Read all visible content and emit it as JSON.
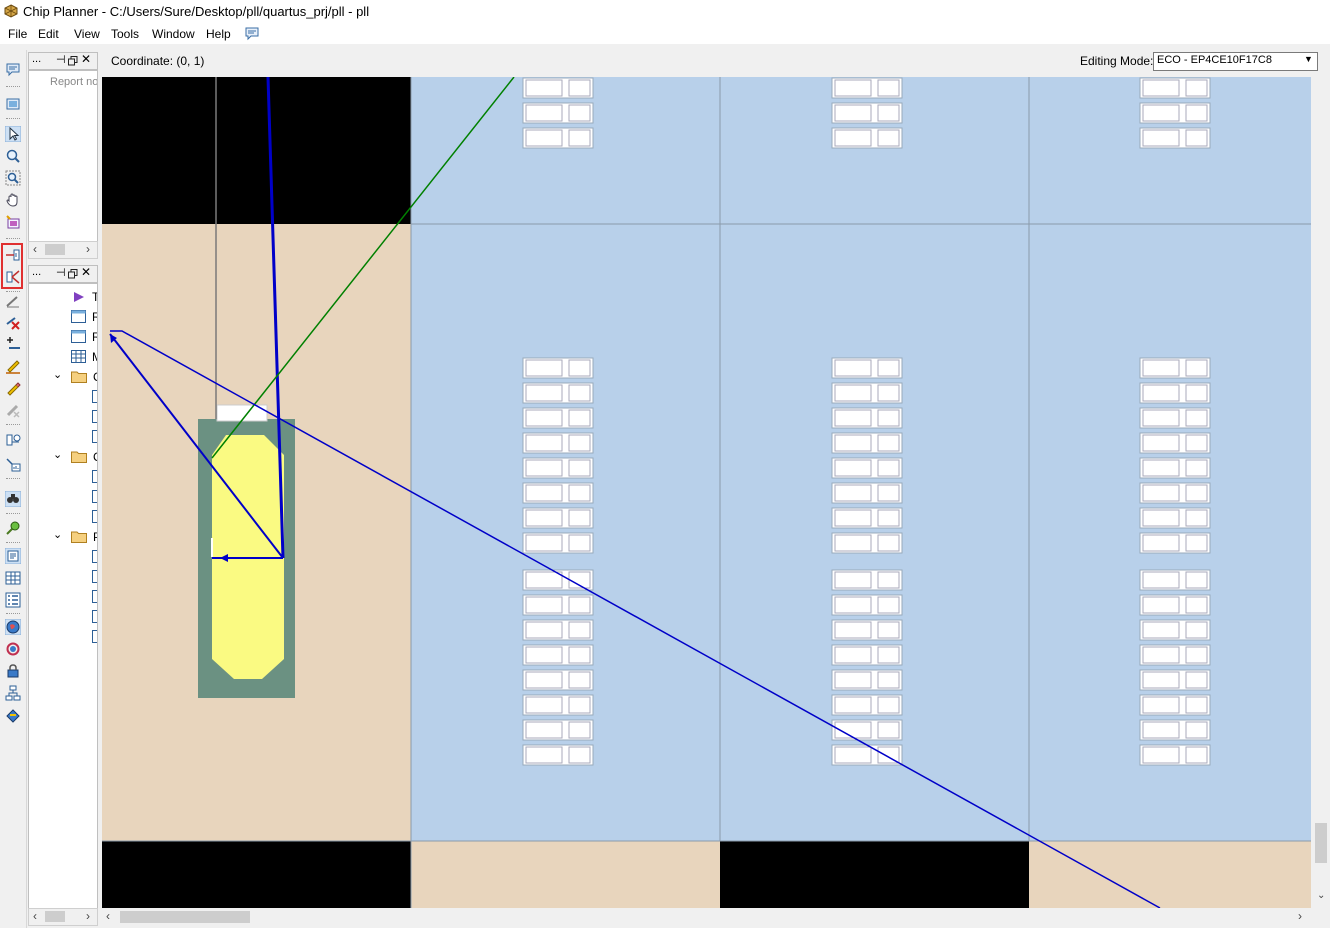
{
  "window": {
    "title": "Chip Planner - C:/Users/Sure/Desktop/pll/quartus_prj/pll - pll"
  },
  "menu": {
    "items": [
      "File",
      "Edit",
      "View",
      "Tools",
      "Window",
      "Help"
    ]
  },
  "pane_top": {
    "head_label": "...",
    "report_text": "Report no"
  },
  "pane_bottom": {
    "head_label": "...",
    "tree_rows": [
      {
        "icon": "play-triangle-icon",
        "text": "T",
        "indent": 1
      },
      {
        "icon": "window-icon",
        "text": "R",
        "indent": 1
      },
      {
        "icon": "window-icon",
        "text": "R",
        "indent": 1
      },
      {
        "icon": "table-icon",
        "text": "M",
        "indent": 1
      },
      {
        "icon": "folder-icon",
        "text": "C",
        "indent": 0,
        "expanded": true
      },
      {
        "icon": "folder-icon",
        "text": "C",
        "indent": 0,
        "expanded": true
      },
      {
        "icon": "folder-icon",
        "text": "P",
        "indent": 0,
        "expanded": true
      }
    ]
  },
  "coord_bar": {
    "label": "Coordinate: (0, 1)",
    "editing_mode_label": "Editing Mode:",
    "editing_mode_value": "ECO - EP4CE10F17C8"
  },
  "toolbar_icons": [
    "comment-icon",
    "layer-settings-icon",
    "select-arrow-icon",
    "zoom-icon",
    "zoom-region-icon",
    "hand-pan-icon",
    "highlight-icon",
    "generate-fan-in-icon",
    "generate-fan-out-icon",
    "draw-line-icon",
    "delete-connection-icon",
    "add-connection-icon",
    "edit-wire-icon",
    "pencil-icon",
    "remove-icon",
    "routing-delay-icon",
    "timing-icon",
    "find-icon",
    "locate-icon",
    "properties-icon",
    "table-icon",
    "list-icon",
    "globe-icon",
    "refresh-icon",
    "lock-icon",
    "hierarchy-icon",
    "paint-icon"
  ],
  "colors": {
    "lab_blue": "#b8d0ea",
    "io_tan": "#e8d5bd",
    "black_region": "#000000",
    "pll_green": "#6b9182",
    "pll_yellow": "#fafa82",
    "route_blue": "#0000c8",
    "route_green": "#008000",
    "toolbar_highlight": "#e03030"
  }
}
